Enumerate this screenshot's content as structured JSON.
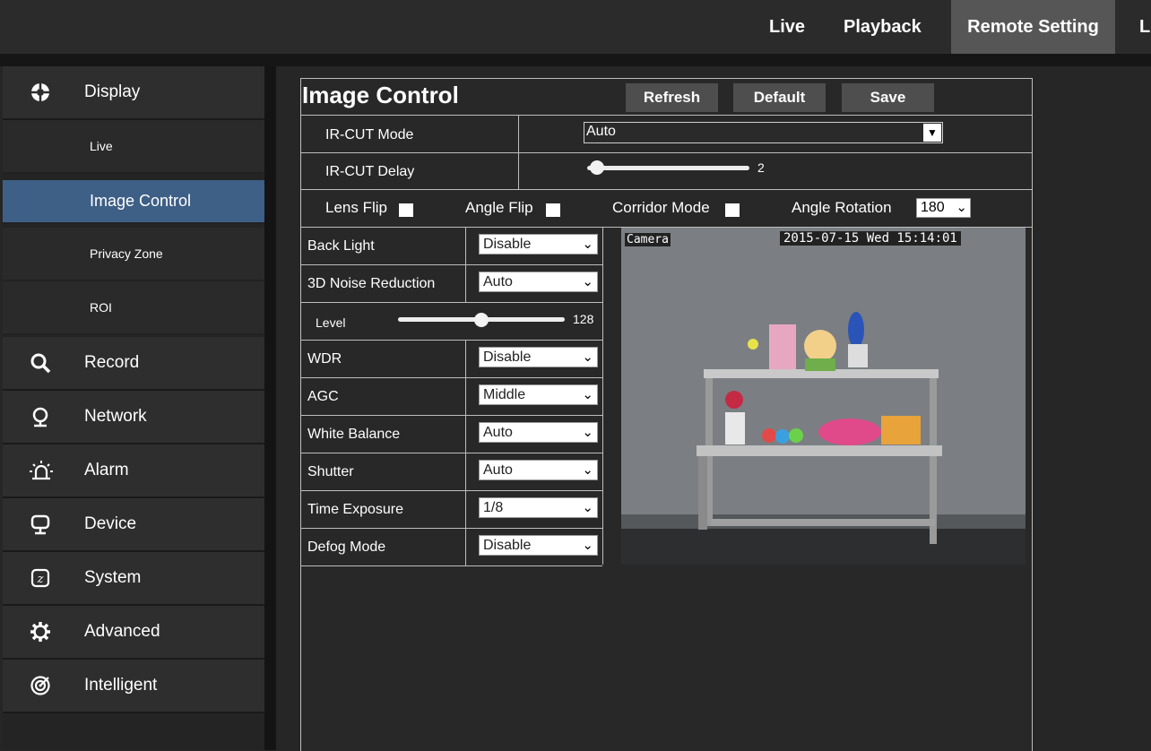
{
  "topnav": {
    "items": [
      "Live",
      "Playback",
      "Remote Setting"
    ],
    "extra": "L",
    "active": "Remote Setting"
  },
  "sidebar": {
    "display": {
      "label": "Display",
      "icon": "aperture-icon"
    },
    "display_sub": [
      {
        "label": "Live"
      },
      {
        "label": "Image Control",
        "active": true
      },
      {
        "label": "Privacy Zone"
      },
      {
        "label": "ROI"
      }
    ],
    "sections": [
      {
        "label": "Record",
        "icon": "search-icon"
      },
      {
        "label": "Network",
        "icon": "network-icon"
      },
      {
        "label": "Alarm",
        "icon": "alarm-icon"
      },
      {
        "label": "Device",
        "icon": "monitor-icon"
      },
      {
        "label": "System",
        "icon": "system-icon"
      },
      {
        "label": "Advanced",
        "icon": "gear-icon"
      },
      {
        "label": "Intelligent",
        "icon": "intelligent-icon"
      }
    ]
  },
  "panel": {
    "title": "Image Control",
    "buttons": {
      "refresh": "Refresh",
      "default": "Default",
      "save": "Save"
    },
    "ircut_mode": {
      "label": "IR-CUT Mode",
      "value": "Auto"
    },
    "ircut_delay": {
      "label": "IR-CUT Delay",
      "value": "2",
      "fraction": 0.06
    },
    "flips": {
      "lens_flip": "Lens Flip",
      "angle_flip": "Angle Flip",
      "corridor_mode": "Corridor Mode",
      "angle_rotation": "Angle Rotation",
      "angle_rotation_value": "180"
    },
    "params": {
      "back_light": {
        "label": "Back Light",
        "value": "Disable"
      },
      "noise_reduction": {
        "label": "3D Noise Reduction",
        "value": "Auto"
      },
      "level": {
        "label": "Level",
        "value": "128",
        "fraction": 0.5
      },
      "wdr": {
        "label": "WDR",
        "value": "Disable"
      },
      "agc": {
        "label": "AGC",
        "value": "Middle"
      },
      "white_balance": {
        "label": "White Balance",
        "value": "Auto"
      },
      "shutter": {
        "label": "Shutter",
        "value": "Auto"
      },
      "time_exposure": {
        "label": "Time Exposure",
        "value": "1/8"
      },
      "defog_mode": {
        "label": "Defog Mode",
        "value": "Disable"
      }
    },
    "preview": {
      "camera_name": "Camera",
      "timestamp": "2015-07-15 Wed 15:14:01"
    }
  },
  "colors": {
    "active_tab": "#565656",
    "active_sidebar": "#3e5f86",
    "background": "#262626"
  }
}
